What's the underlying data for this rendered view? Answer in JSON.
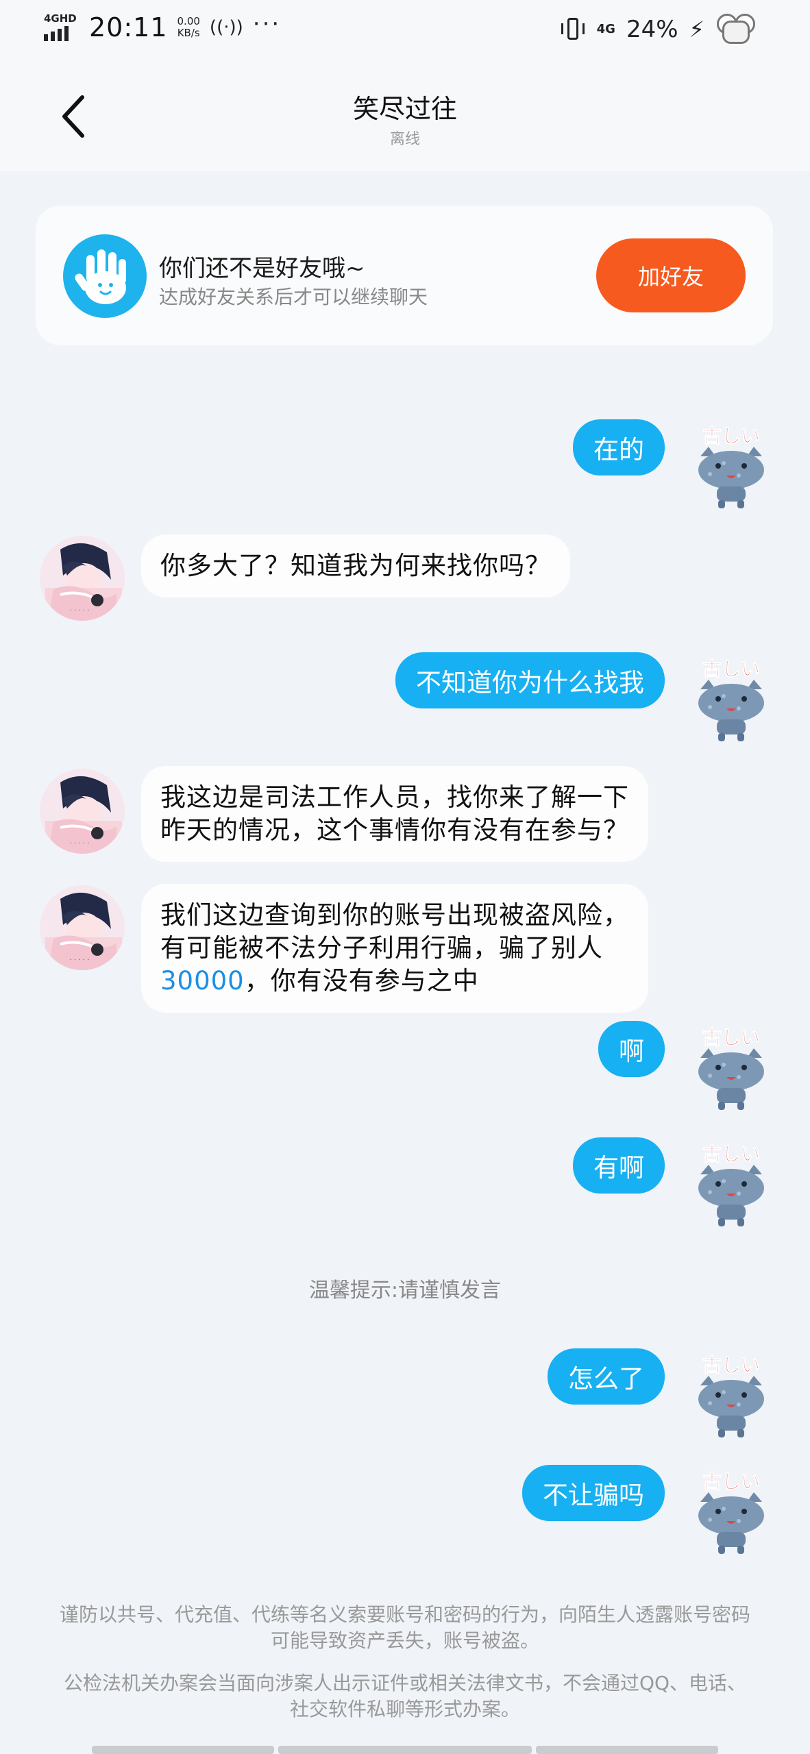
{
  "status_bar": {
    "network": "4GHD",
    "time": "20:11",
    "speed_value": "0.00",
    "speed_unit": "KB/s",
    "net_right": "4G",
    "battery": "24%"
  },
  "header": {
    "title": "笑尽过往",
    "status": "离线"
  },
  "banner": {
    "title": "你们还不是好友哦~",
    "subtitle": "达成好友关系后才可以继续聊天",
    "button": "加好友"
  },
  "messages": [
    {
      "side": "out",
      "text": "在的"
    },
    {
      "side": "in",
      "text": "你多大了？知道我为何来找你吗？"
    },
    {
      "side": "out",
      "text": "不知道你为什么找我"
    },
    {
      "side": "in",
      "lines": [
        "我这边是司法工作人员，找你来了解一下",
        "昨天的情况，这个事情你有没有在参与？"
      ]
    },
    {
      "side": "in",
      "lines": [
        "我们这边查询到你的账号出现被盗风险，",
        "有可能被不法分子利用行骗，骗了别人"
      ],
      "highlight": "30000",
      "tail": "，你有没有参与之中"
    },
    {
      "side": "out",
      "text": "啊"
    },
    {
      "side": "out",
      "text": "有啊"
    },
    {
      "side": "out",
      "text": "怎么了"
    },
    {
      "side": "out",
      "text": "不让骗吗"
    }
  ],
  "tip": "温馨提示:请谨慎发言",
  "sticker_text": "古しい",
  "footer": {
    "line1": "谨防以共号、代充值、代练等名义索要账号和密码的行为，向陌生人透露账号密码可能导致资产丢失，账号被盗。",
    "line2": "公检法机关办案会当面向涉案人出示证件或相关法律文书，不会通过QQ、电话、社交软件私聊等形式办案。"
  },
  "colors": {
    "accent": "#17b0f2",
    "add_button": "#f75a1e",
    "background": "#f0f3f7"
  }
}
